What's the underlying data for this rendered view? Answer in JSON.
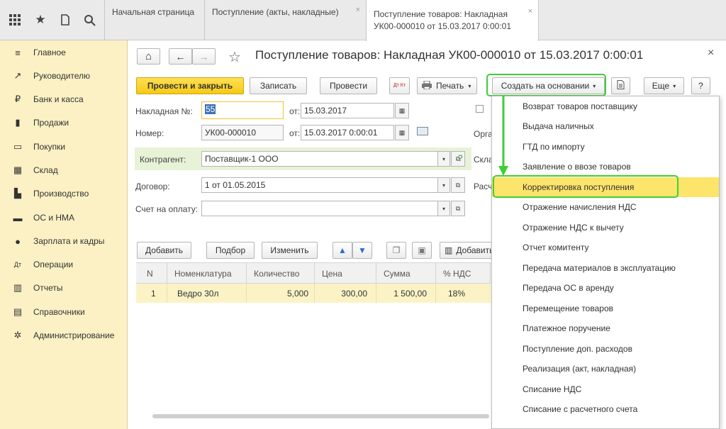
{
  "topbar": {
    "icons": [
      "apps-grid-icon",
      "star-icon",
      "history-icon",
      "search-icon"
    ],
    "tabs": [
      {
        "label": "Начальная страница"
      },
      {
        "label": "Поступление (акты, накладные)"
      },
      {
        "label_line1": "Поступление товаров: Накладная",
        "label_line2": "УК00-000010 от 15.03.2017 0:00:01"
      }
    ],
    "close_glyph": "×"
  },
  "sidebar": {
    "items": [
      {
        "icon": "≡",
        "label": "Главное"
      },
      {
        "icon": "↗",
        "label": "Руководителю"
      },
      {
        "icon": "₽",
        "label": "Банк и касса"
      },
      {
        "icon": "▮",
        "label": "Продажи"
      },
      {
        "icon": "▭",
        "label": "Покупки"
      },
      {
        "icon": "▦",
        "label": "Склад"
      },
      {
        "icon": "▙",
        "label": "Производство"
      },
      {
        "icon": "▬",
        "label": "ОС и НМА"
      },
      {
        "icon": "●",
        "label": "Зарплата и кадры"
      },
      {
        "icon": "Дт",
        "label": "Операции"
      },
      {
        "icon": "▥",
        "label": "Отчеты"
      },
      {
        "icon": "▤",
        "label": "Справочники"
      },
      {
        "icon": "✲",
        "label": "Администрирование"
      }
    ]
  },
  "doc": {
    "title": "Поступление товаров: Накладная УК00-000010 от 15.03.2017 0:00:01",
    "close": "×",
    "nav_home": "⌂",
    "nav_back": "←",
    "nav_fwd": "→",
    "star": "☆"
  },
  "toolbar": {
    "post_close": "Провести и закрыть",
    "save": "Записать",
    "post": "Провести",
    "dtkt": "Дт Кт",
    "print": "Печать",
    "create_based": "Создать на основании",
    "more": "Еще",
    "help": "?"
  },
  "form": {
    "invoice_label": "Накладная №:",
    "invoice_value": "55",
    "from1": "от:",
    "date1": "15.03.2017",
    "number_label": "Номер:",
    "number_value": "УК00-000010",
    "from2": "от:",
    "date2": "15.03.2017  0:00:01",
    "counterparty_label": "Контрагент:",
    "counterparty_value": "Поставщик-1 ООО",
    "contract_label": "Договор:",
    "contract_value": "1 от 01.05.2015",
    "invoice_pay_label": "Счет на оплату:",
    "invoice_pay_value": "",
    "right_labels": [
      "Орга",
      "Скла",
      "Расч"
    ]
  },
  "table_toolbar": {
    "add": "Добавить",
    "select": "Подбор",
    "change": "Изменить",
    "add_barcode": "Добавить"
  },
  "table": {
    "columns": [
      "N",
      "Номенклатура",
      "Количество",
      "Цена",
      "Сумма",
      "% НДС"
    ],
    "rows": [
      [
        "1",
        "Ведро 30л",
        "5,000",
        "300,00",
        "1 500,00",
        "18%"
      ]
    ]
  },
  "dropdown": {
    "items": [
      "Возврат товаров поставщику",
      "Выдача наличных",
      "ГТД по импорту",
      "Заявление о ввозе товаров",
      "Корректировка поступления",
      "Отражение начисления НДС",
      "Отражение НДС к вычету",
      "Отчет комитенту",
      "Передача материалов в эксплуатацию",
      "Передача ОС в аренду",
      "Перемещение товаров",
      "Платежное поручение",
      "Поступление доп. расходов",
      "Реализация (акт, накладная)",
      "Списание НДС",
      "Списание с расчетного счета"
    ],
    "highlighted": "Корректировка поступления"
  },
  "colors": {
    "accent_yellow": "#f5c914",
    "sidebar_bg": "#fbf1c4",
    "highlight_green": "#3ecf37"
  }
}
